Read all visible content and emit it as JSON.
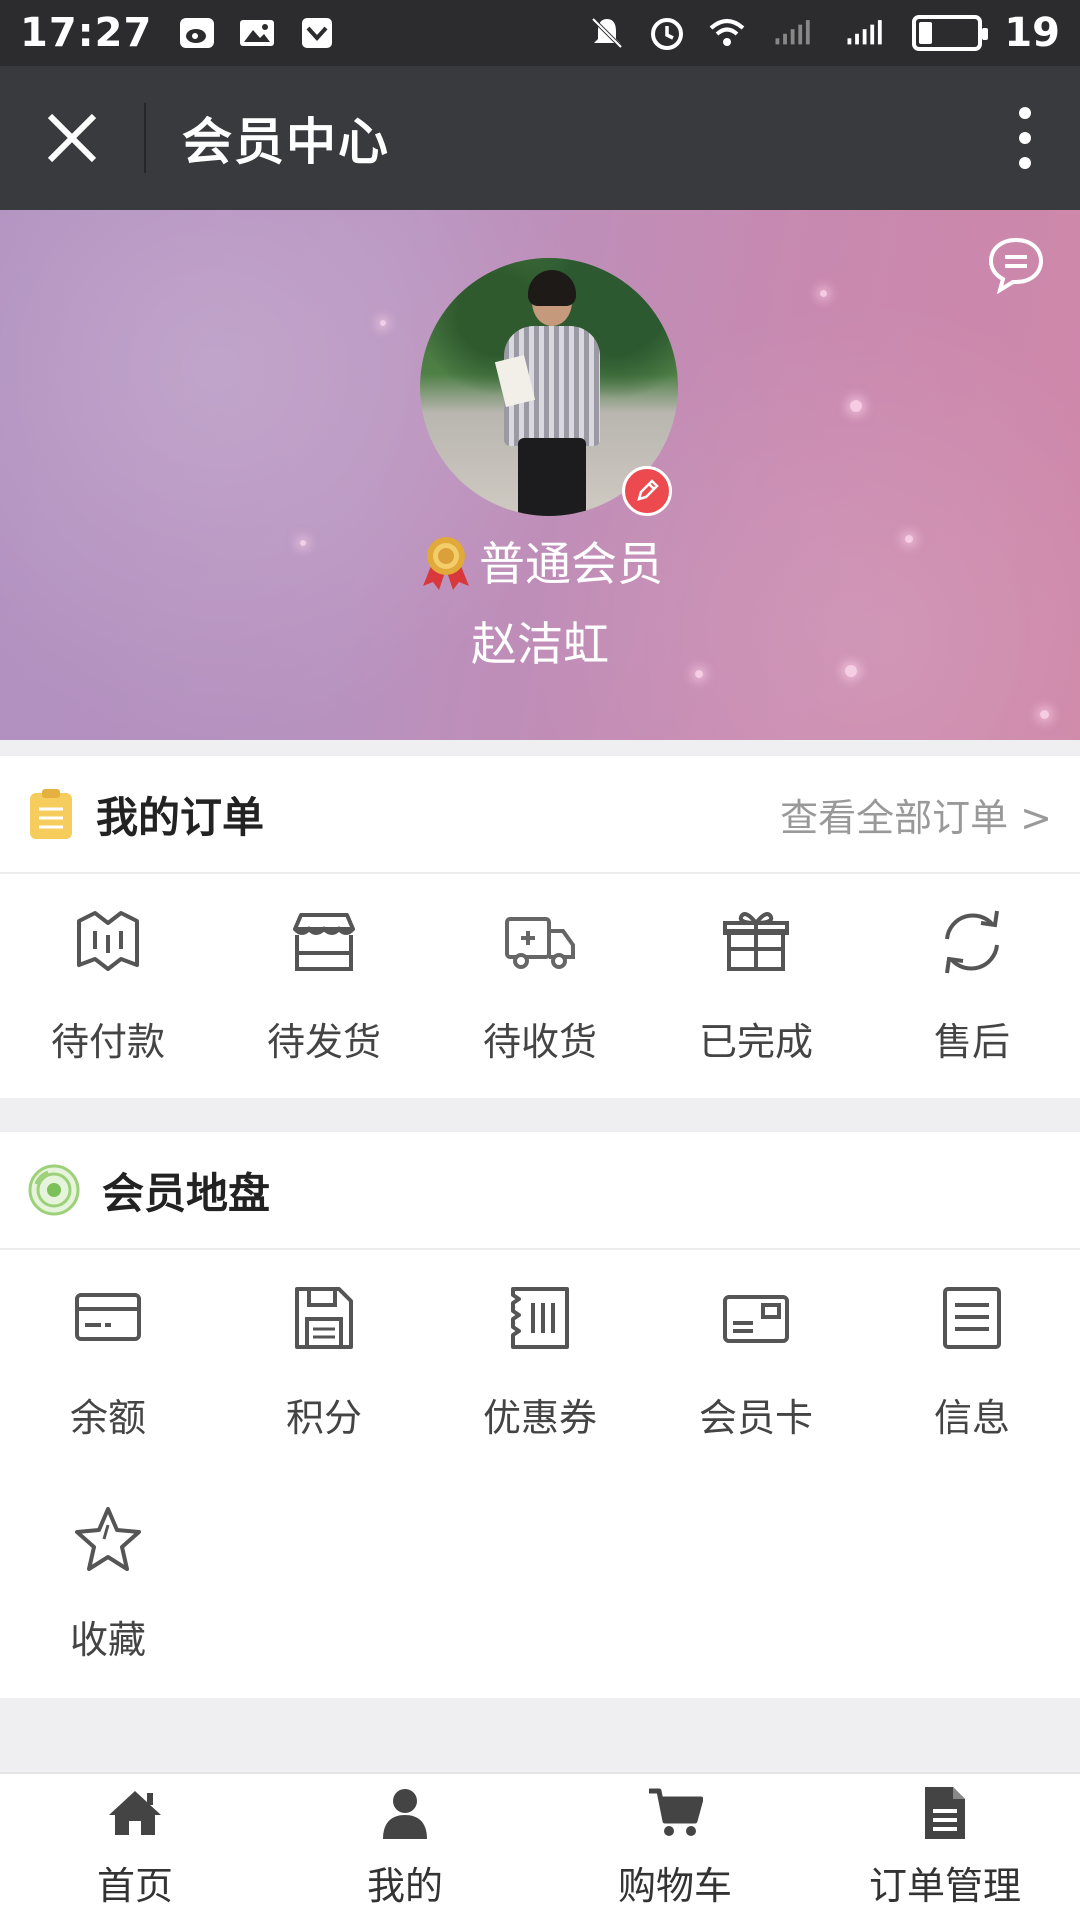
{
  "status_bar": {
    "time": "17:27",
    "battery_level": "19"
  },
  "title_bar": {
    "title": "会员中心"
  },
  "profile": {
    "level": "普通会员",
    "name": "赵洁虹"
  },
  "orders": {
    "title": "我的订单",
    "view_all": "查看全部订单 >",
    "items": [
      {
        "label": "待付款",
        "icon": "map-icon"
      },
      {
        "label": "待发货",
        "icon": "store-icon"
      },
      {
        "label": "待收货",
        "icon": "truck-icon"
      },
      {
        "label": "已完成",
        "icon": "gift-icon"
      },
      {
        "label": "售后",
        "icon": "refresh-icon"
      }
    ]
  },
  "member": {
    "title": "会员地盘",
    "items": [
      {
        "label": "余额",
        "icon": "card-icon"
      },
      {
        "label": "积分",
        "icon": "save-icon"
      },
      {
        "label": "优惠券",
        "icon": "coupon-icon"
      },
      {
        "label": "会员卡",
        "icon": "member-card-icon"
      },
      {
        "label": "信息",
        "icon": "document-icon"
      },
      {
        "label": "收藏",
        "icon": "star-icon"
      }
    ]
  },
  "bottom_nav": {
    "items": [
      {
        "label": "首页",
        "icon": "home-icon"
      },
      {
        "label": "我的",
        "icon": "user-icon"
      },
      {
        "label": "购物车",
        "icon": "cart-icon"
      },
      {
        "label": "订单管理",
        "icon": "document-icon"
      }
    ]
  }
}
